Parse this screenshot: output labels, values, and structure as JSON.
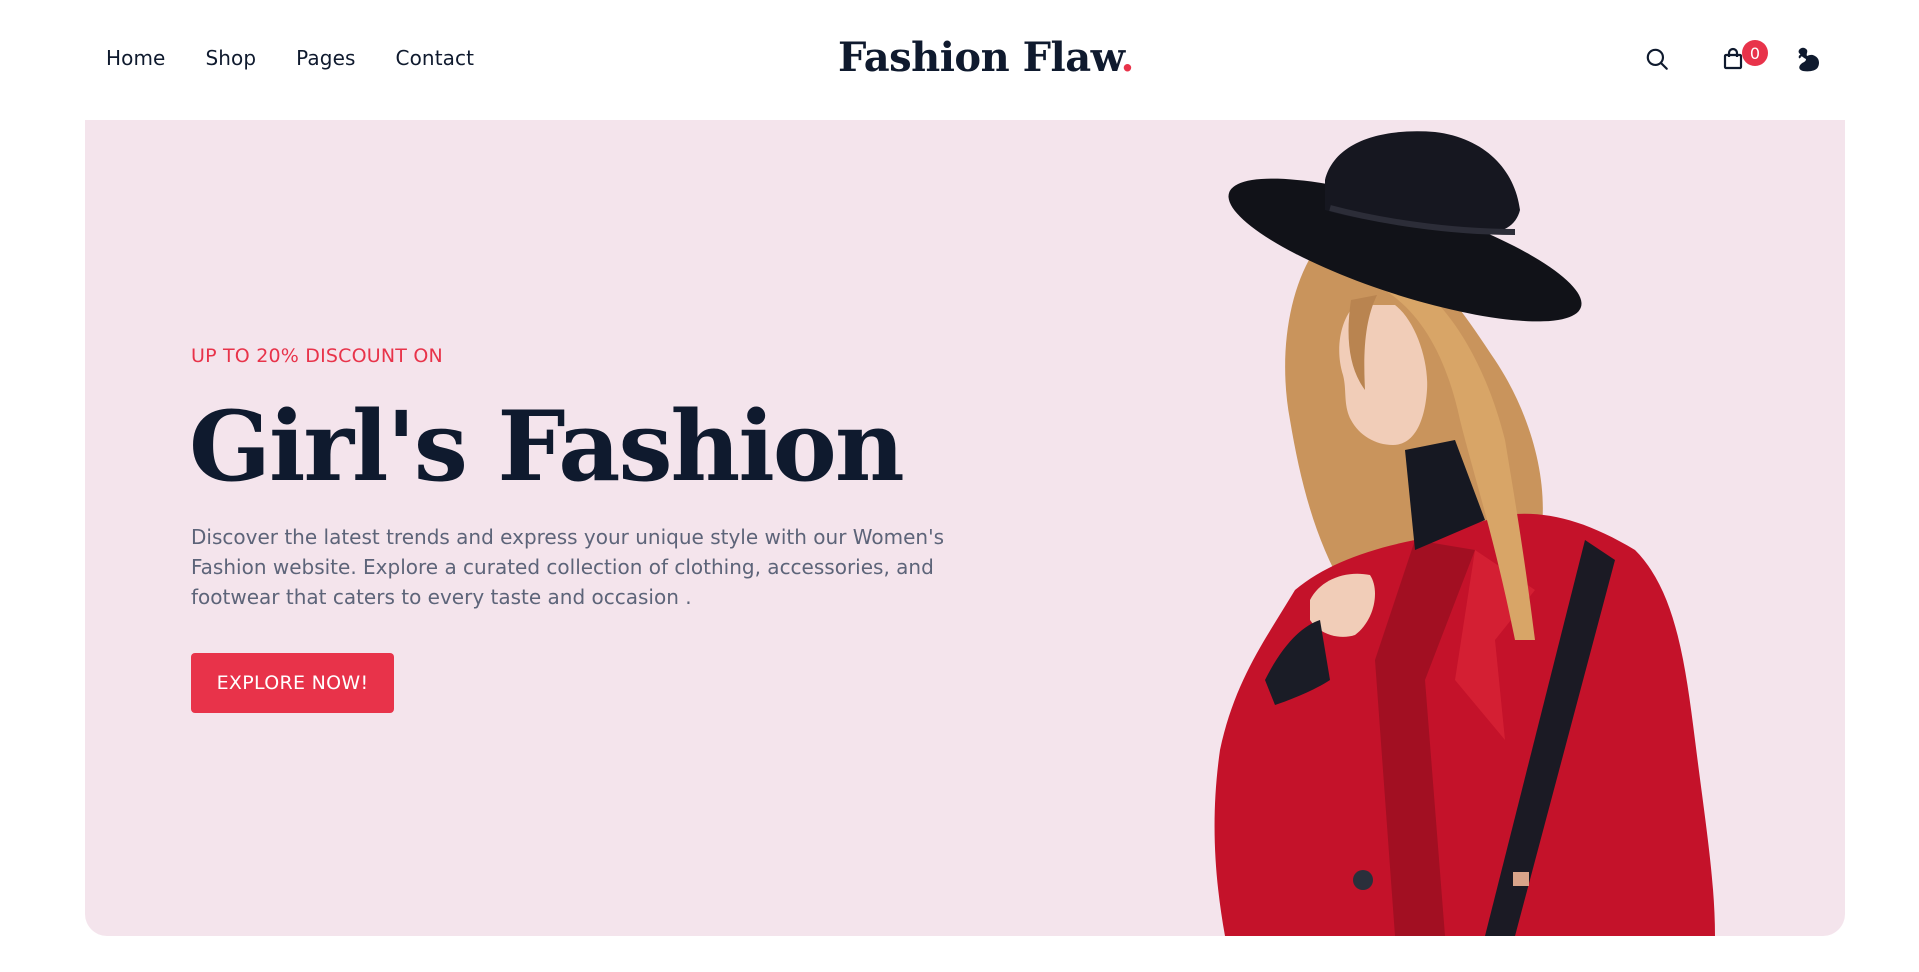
{
  "nav": {
    "items": [
      {
        "label": "Home"
      },
      {
        "label": "Shop"
      },
      {
        "label": "Pages"
      },
      {
        "label": "Contact"
      }
    ]
  },
  "logo": {
    "text": "Fashion Flaw",
    "dot": "."
  },
  "header_tools": {
    "search_icon": "search-icon",
    "cart_icon": "bag-icon",
    "cart_count": "0",
    "user_icon": "user-icon"
  },
  "hero": {
    "eyebrow": "UP TO 20% DISCOUNT ON",
    "title": "Girl's Fashion",
    "description": "Discover the latest trends and express your unique style with our Women's Fashion website. Explore a curated collection of clothing, accessories, and footwear that caters to every taste and occasion .",
    "cta_label": "EXPLORE NOW!",
    "image": "woman-in-red-coat-and-black-hat"
  },
  "colors": {
    "accent": "#e8334a",
    "hero_background": "#f4e4ec",
    "text_dark": "#0f1a2e",
    "text_muted": "#5d6479"
  }
}
